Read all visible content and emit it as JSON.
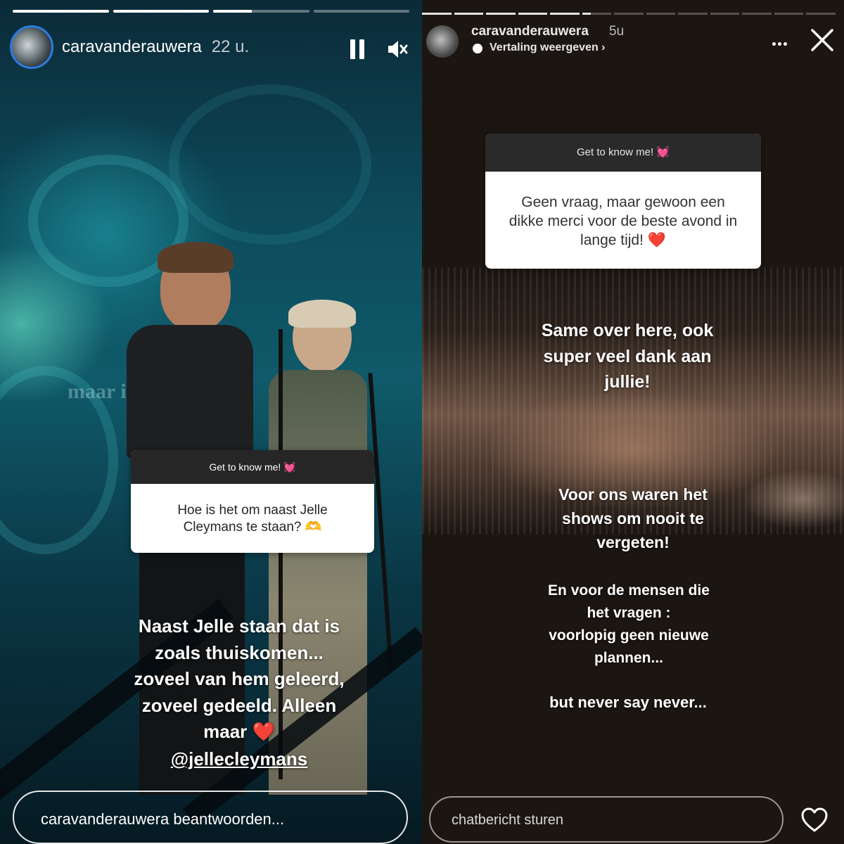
{
  "left": {
    "progress": [
      1.0,
      1.0,
      0.4,
      0.0
    ],
    "username": "caravanderauwera",
    "time": "22 u.",
    "question_card": {
      "header": "Get to know me! 💓",
      "question": "Hoe is het om naast Jelle Cleymans te staan? 🫶"
    },
    "answer_lines": [
      "Naast Jelle staan dat is",
      "zoals thuiskomen...",
      "zoveel van hem geleerd,",
      "zoveel gedeeld. Alleen",
      "maar ❤️"
    ],
    "mention": "@jellecleymans",
    "reply_placeholder": "caravanderauwera beantwoorden...",
    "background_text": "maar ik"
  },
  "right": {
    "username": "caravanderauwera",
    "time": "5u",
    "translation": "Vertaling weergeven",
    "question_card": {
      "header": "Get to know me! 💓",
      "question": "Geen vraag, maar gewoon een dikke merci voor de beste avond in lange tijd! ❤️"
    },
    "answer1_lines": [
      "Same over here, ook",
      "super veel dank aan",
      "jullie!"
    ],
    "answer2_lines": [
      "Voor ons waren het",
      "shows om nooit te",
      "vergeten!"
    ],
    "answer3_lines": [
      "En voor de mensen die",
      "het vragen :",
      "voorlopig geen nieuwe",
      "plannen..."
    ],
    "answer4": "but never say never...",
    "chat_placeholder": "chatbericht sturen"
  },
  "colors": {
    "avatar_ring": "#2d7be0",
    "left_bg": "#0f5a6a",
    "right_bg": "#1c1612"
  },
  "icons": [
    "pause-icon",
    "mute-icon",
    "more-icon",
    "close-icon",
    "heart-icon",
    "globe-icon"
  ]
}
